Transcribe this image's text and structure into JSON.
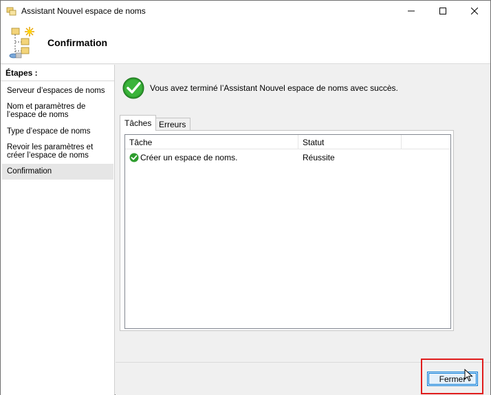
{
  "window": {
    "title": "Assistant Nouvel espace de noms",
    "icon": "namespace-wizard-icon"
  },
  "header": {
    "title": "Confirmation",
    "icon": "namespace-tree-icon"
  },
  "sidebar": {
    "heading": "Étapes :",
    "steps": [
      {
        "label": "Serveur d’espaces de noms",
        "active": false
      },
      {
        "label": "Nom et paramètres de l’espace de noms",
        "active": false
      },
      {
        "label": "Type d’espace de noms",
        "active": false
      },
      {
        "label": "Revoir les paramètres et créer l’espace de noms",
        "active": false
      },
      {
        "label": "Confirmation",
        "active": true
      }
    ]
  },
  "main": {
    "success_message": "Vous avez terminé l’Assistant Nouvel espace de noms avec succès.",
    "tabs": [
      {
        "label": "Tâches",
        "active": true
      },
      {
        "label": "Erreurs",
        "active": false
      }
    ],
    "table": {
      "columns": [
        "Tâche",
        "Statut"
      ],
      "rows": [
        {
          "task": "Créer un espace de noms.",
          "status": "Réussite",
          "icon": "success-check-icon"
        }
      ]
    }
  },
  "footer": {
    "close_label": "Fermer"
  },
  "colors": {
    "accent": "#0078d7",
    "success": "#2e9d2e",
    "highlight": "#e01b1b"
  }
}
